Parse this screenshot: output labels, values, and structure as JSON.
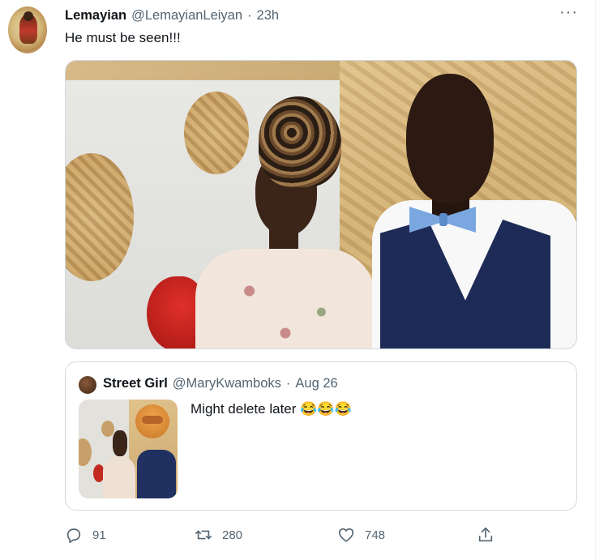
{
  "tweet": {
    "author_name": "Lemayian",
    "author_handle": "@LemayianLeiyan",
    "separator": "·",
    "timestamp": "23h",
    "text": "He must be seen!!!",
    "more_glyph": "···"
  },
  "quote": {
    "author_name": "Street Girl",
    "author_handle": "@MaryKwamboks",
    "separator": "·",
    "timestamp": "Aug 26",
    "text": "Might delete later 😂😂😂"
  },
  "actions": {
    "replies": "91",
    "retweets": "280",
    "likes": "748"
  },
  "icons": {
    "reply": "reply-icon",
    "retweet": "retweet-icon",
    "like": "heart-icon",
    "share": "share-icon",
    "more": "more-icon"
  },
  "colors": {
    "text_primary": "#0f1419",
    "text_secondary": "#536471",
    "border": "#cfd9de"
  }
}
